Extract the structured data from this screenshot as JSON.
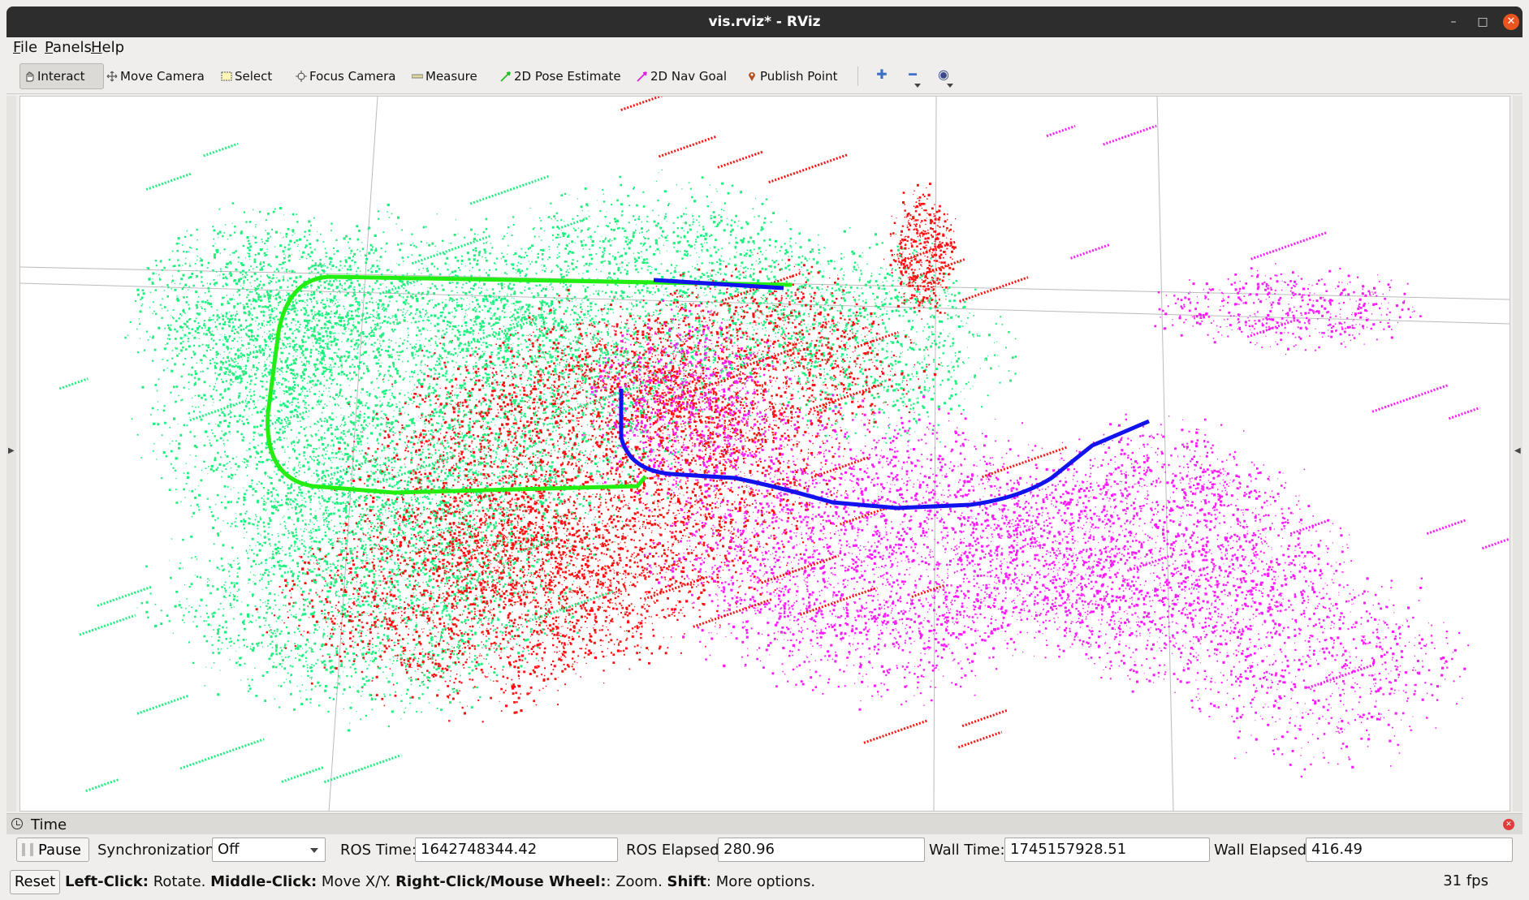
{
  "window": {
    "title": "vis.rviz* - RViz",
    "min_glyph": "–",
    "max_glyph": "□",
    "close_glyph": "✕"
  },
  "menu": [
    {
      "first": "F",
      "rest": "ile"
    },
    {
      "first": "P",
      "rest": "anels"
    },
    {
      "first": "H",
      "rest": "elp"
    }
  ],
  "toolbar": {
    "interact": "Interact",
    "move_camera": "Move Camera",
    "select": "Select",
    "focus_camera": "Focus Camera",
    "measure": "Measure",
    "pose_estimate": "2D Pose Estimate",
    "nav_goal": "2D Nav Goal",
    "publish_point": "Publish Point",
    "zoom_in_glyph": "✚",
    "zoom_out_glyph": "━",
    "eye_glyph": "◉"
  },
  "colors": {
    "cloud_green": "#1ef07e",
    "cloud_red": "#ff1010",
    "cloud_magenta": "#ff19ff",
    "path_green": "#22ee11",
    "path_blue": "#1212ee",
    "grid": "#bbbbbb"
  },
  "time_panel": {
    "title": "Time",
    "pause": "Pause",
    "sync_label": "Synchronization:",
    "sync_value": "Off",
    "ros_time_label": "ROS Time:",
    "ros_time": "1642748344.42",
    "ros_elapsed_label": "ROS Elapsed:",
    "ros_elapsed": "280.96",
    "wall_time_label": "Wall Time:",
    "wall_time": "1745157928.51",
    "wall_elapsed_label": "Wall Elapsed:",
    "wall_elapsed": "416.49"
  },
  "status": {
    "reset": "Reset",
    "left_click": "Left-Click:",
    "left_click_action": " Rotate. ",
    "middle_click": "Middle-Click:",
    "middle_click_action": " Move X/Y. ",
    "right_click": "Right-Click/Mouse Wheel:",
    "right_click_action": ": Zoom. ",
    "shift": "Shift",
    "shift_action": ": More options.",
    "fps": "31 fps"
  }
}
